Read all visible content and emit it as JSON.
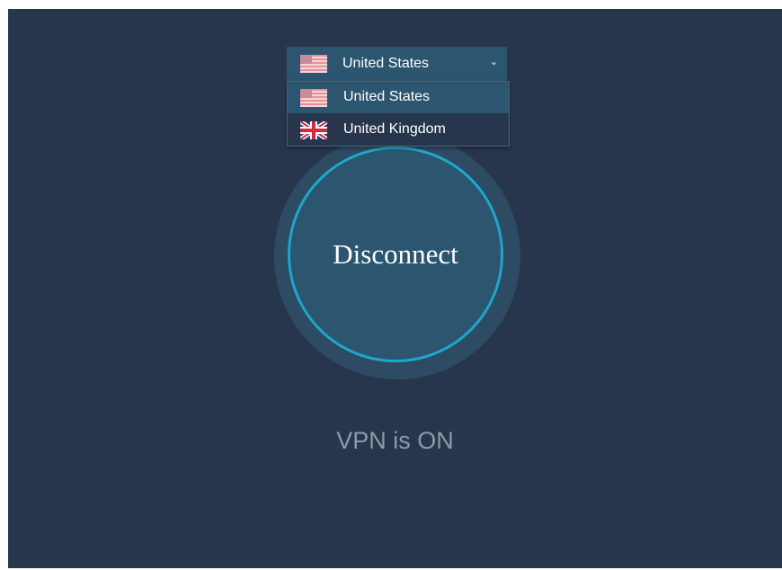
{
  "country_select": {
    "selected_label": "United States",
    "selected_flag": "us-flag-icon",
    "chevron_icon": "chevron-down-icon"
  },
  "dropdown": {
    "options": [
      {
        "label": "United States",
        "flag": "us-flag-icon",
        "highlighted": true
      },
      {
        "label": "United Kingdom",
        "flag": "uk-flag-icon",
        "highlighted": false
      }
    ]
  },
  "main": {
    "disconnect_label": "Disconnect",
    "status_text": "VPN is ON"
  },
  "colors": {
    "background": "#27364d",
    "panel": "#2c5570",
    "ring": "#1fa6cb",
    "halo": "#2d4b63",
    "status_text": "#8e99a8"
  }
}
